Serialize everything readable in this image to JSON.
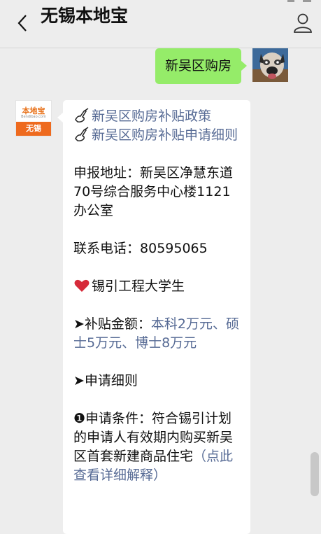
{
  "header": {
    "title": "无锡本地宝"
  },
  "outgoing_message": {
    "text": "新吴区购房"
  },
  "bot_avatar": {
    "logo_text": "本地宝",
    "logo_sub": "Bendibao.com",
    "logo_city": "无锡"
  },
  "message": {
    "link1": "新吴区购房补贴政策",
    "link2": "新吴区购房补贴申请细则",
    "address_label": "申报地址：",
    "address_value": "新吴区净慧东道70号综合服务中心楼1121办公室",
    "phone_label": "联系电话：",
    "phone_value": "80595065",
    "section_title": "锡引工程大学生",
    "subsidy_label": "➤补贴金额：",
    "subsidy_value": "本科2万元、硕士5万元、博士8万元",
    "rules_title": "➤申请细则",
    "conditions_text": "❶申请条件：符合锡引计划的申请人有效期内购买新吴区首套新建商品住宅",
    "conditions_link": "（点此查看详细解释）"
  },
  "colors": {
    "outgoing_bubble": "#95ec69",
    "link": "#576b95",
    "background": "#ededed",
    "logo_orange": "#ee6a1e"
  },
  "icons": [
    "back-arrow-icon",
    "profile-icon",
    "writing-hand-icon",
    "heart-icon"
  ]
}
